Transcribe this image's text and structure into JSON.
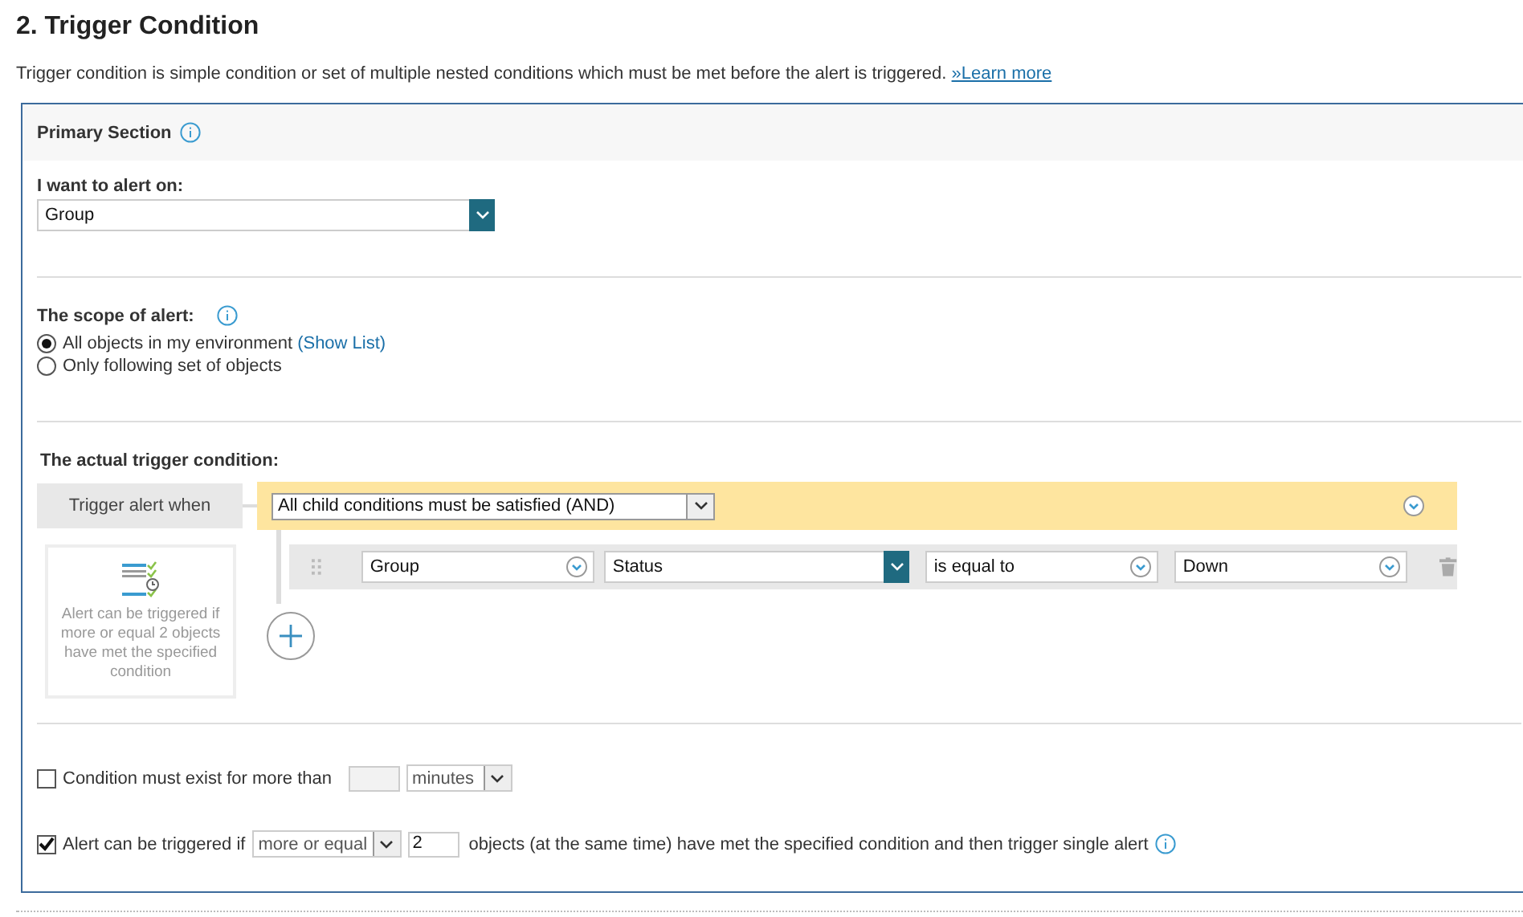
{
  "heading": "2. Trigger Condition",
  "description": "Trigger condition is simple condition or set of multiple nested conditions which must be met before the alert is triggered. ",
  "learn_more": "»Learn more",
  "section_title": "Primary Section",
  "alert_on": {
    "label": "I want to alert on:",
    "value": "Group"
  },
  "scope": {
    "label": "The scope of alert:",
    "options": [
      {
        "label": "All objects in my environment",
        "link": "(Show List)",
        "selected": true
      },
      {
        "label": "Only following set of objects",
        "selected": false
      }
    ]
  },
  "trigger": {
    "label": "The actual trigger condition:",
    "when_label": "Trigger alert when",
    "mode": "All child conditions must be satisfied (AND)",
    "card_text": "Alert can be triggered if more or equal 2 objects have met the specified condition",
    "condition": [
      {
        "kind": "circle",
        "value": "Group"
      },
      {
        "kind": "teal",
        "value": "Status"
      },
      {
        "kind": "circle",
        "value": "is equal to"
      },
      {
        "kind": "circle",
        "value": "Down"
      }
    ]
  },
  "duration": {
    "checked": false,
    "label": "Condition must exist for more than",
    "unit": "minutes"
  },
  "count": {
    "checked": true,
    "label": "Alert can be triggered if",
    "operator": "more or equal",
    "value": "2",
    "tail": "objects (at the same time) have met the specified condition and then trigger single alert"
  }
}
